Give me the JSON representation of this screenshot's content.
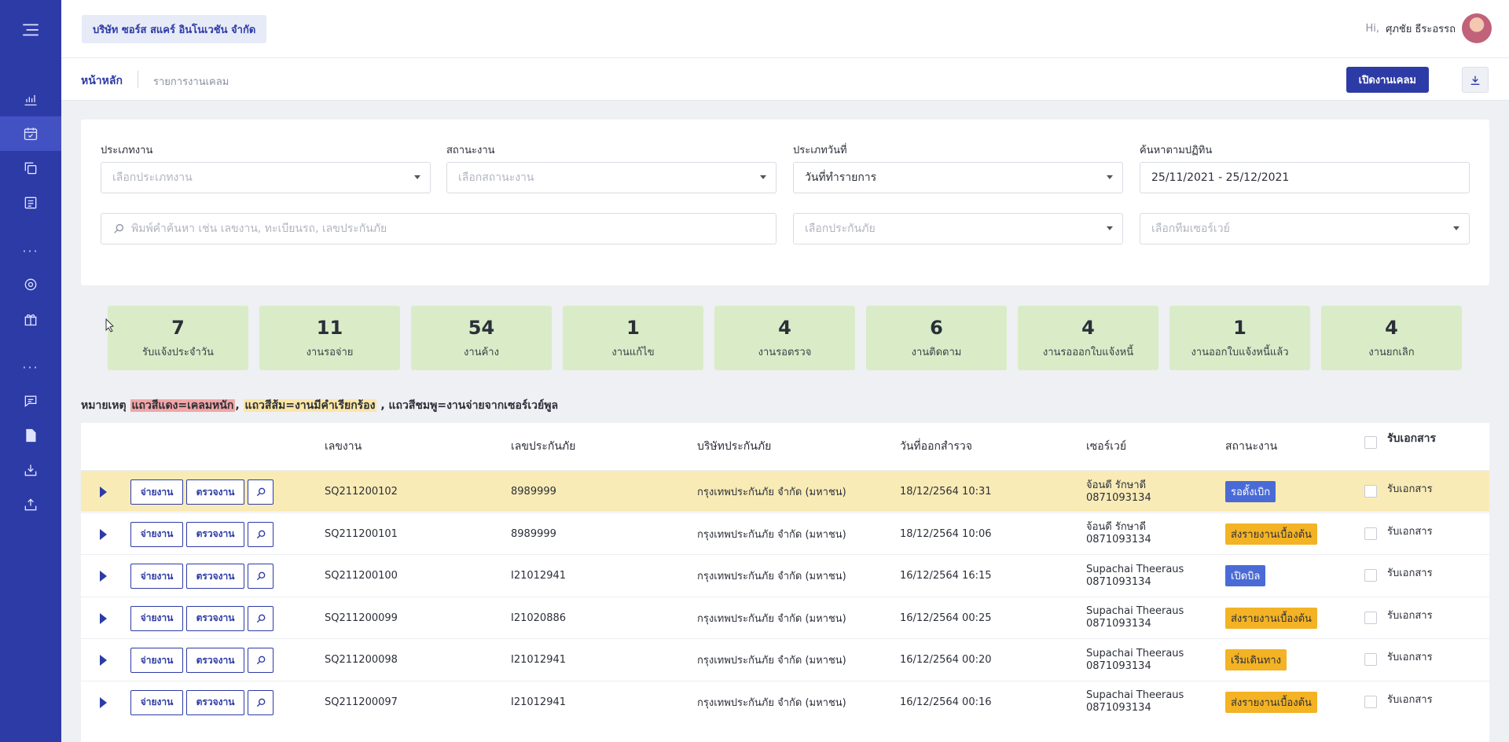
{
  "colors": {
    "sidebar": "#2d3ba6",
    "primary": "#2d3ba6",
    "card_bg": "#d9ecc7",
    "highlight_row": "#f9ebb5",
    "badge_blue": "#4a6bd6",
    "badge_orange": "#f3b325"
  },
  "header": {
    "company": "บริษัท ซอร์ส สแคร์ อินโนเวชัน จำกัด",
    "greeting": "Hi,",
    "user_name": "ศุภชัย ธีระอรรถ"
  },
  "breadcrumb": {
    "home": "หน้าหลัก",
    "current": "รายการงานเคลม"
  },
  "actions": {
    "open_claim": "เปิดงานเคลม",
    "download_icon": "download-icon"
  },
  "filters": {
    "job_type": {
      "label": "ประเภทงาน",
      "placeholder": "เลือกประเภทงาน"
    },
    "job_status": {
      "label": "สถานะงาน",
      "placeholder": "เลือกสถานะงาน"
    },
    "date_type": {
      "label": "ประเภทวันที่",
      "value": "วันที่ทำรายการ"
    },
    "date_range": {
      "label": "ค้นหาตามปฏิทิน",
      "value": "25/11/2021 - 25/12/2021"
    },
    "search": {
      "placeholder": "พิมพ์คำค้นหา เช่น เลขงาน, ทะเบียนรถ, เลขประกันภัย"
    },
    "insurer": {
      "placeholder": "เลือกประกันภัย"
    },
    "survey_team": {
      "placeholder": "เลือกทีมเซอร์เวย์"
    }
  },
  "summary": [
    {
      "count": "7",
      "label": "รับแจ้งประจำวัน"
    },
    {
      "count": "11",
      "label": "งานรอจ่าย"
    },
    {
      "count": "54",
      "label": "งานค้าง"
    },
    {
      "count": "1",
      "label": "งานแก้ไข"
    },
    {
      "count": "4",
      "label": "งานรอตรวจ"
    },
    {
      "count": "6",
      "label": "งานติดตาม"
    },
    {
      "count": "4",
      "label": "งานรอออกใบแจ้งหนี้"
    },
    {
      "count": "1",
      "label": "งานออกใบแจ้งหนี้แล้ว"
    },
    {
      "count": "4",
      "label": "งานยกเลิก"
    }
  ],
  "note": {
    "prefix": "หมายเหตุ",
    "red": "แถวสีแดง=เคลมหนัก",
    "sep1": ",",
    "orange": "แถวสีส้ม=งานมีคำเรียกร้อง",
    "rest": ", แถวสีชมพู=งานจ่ายจากเซอร์เวย์พูล"
  },
  "table": {
    "headers": {
      "job_no": "เลขงาน",
      "policy_no": "เลขประกันภัย",
      "insurer": "บริษัทประกันภัย",
      "survey_date": "วันที่ออกสำรวจ",
      "surveyor": "เซอร์เวย์",
      "status": "สถานะงาน",
      "receive_doc": "รับเอกสาร"
    },
    "action_labels": {
      "assign": "จ่ายงาน",
      "inspect": "ตรวจงาน"
    },
    "rows": [
      {
        "job_no": "SQ211200102",
        "policy_no": "8989999",
        "insurer": "กรุงเทพประกันภัย จำกัด (มหาชน)",
        "survey_date": "18/12/2564 10:31",
        "surveyor_name": "จ้อนดี รักษาดี",
        "surveyor_phone": "0871093134",
        "status": "รอตั้งเบิก",
        "status_color": "#4a6bd6",
        "status_text_color": "#ffffff",
        "receive_doc": "รับเอกสาร",
        "highlight": true
      },
      {
        "job_no": "SQ211200101",
        "policy_no": "8989999",
        "insurer": "กรุงเทพประกันภัย จำกัด (มหาชน)",
        "survey_date": "18/12/2564 10:06",
        "surveyor_name": "จ้อนดี รักษาดี",
        "surveyor_phone": "0871093134",
        "status": "ส่งรายงานเบื้องต้น",
        "status_color": "#f3b325",
        "status_text_color": "#2b2f38",
        "receive_doc": "รับเอกสาร",
        "highlight": false
      },
      {
        "job_no": "SQ211200100",
        "policy_no": "I21012941",
        "insurer": "กรุงเทพประกันภัย จำกัด (มหาชน)",
        "survey_date": "16/12/2564 16:15",
        "surveyor_name": "Supachai Theeraus",
        "surveyor_phone": "0871093134",
        "status": "เปิดบิล",
        "status_color": "#4a6bd6",
        "status_text_color": "#ffffff",
        "receive_doc": "รับเอกสาร",
        "highlight": false
      },
      {
        "job_no": "SQ211200099",
        "policy_no": "I21020886",
        "insurer": "กรุงเทพประกันภัย จำกัด (มหาชน)",
        "survey_date": "16/12/2564 00:25",
        "surveyor_name": "Supachai Theeraus",
        "surveyor_phone": "0871093134",
        "status": "ส่งรายงานเบื้องต้น",
        "status_color": "#f3b325",
        "status_text_color": "#2b2f38",
        "receive_doc": "รับเอกสาร",
        "highlight": false
      },
      {
        "job_no": "SQ211200098",
        "policy_no": "I21012941",
        "insurer": "กรุงเทพประกันภัย จำกัด (มหาชน)",
        "survey_date": "16/12/2564 00:20",
        "surveyor_name": "Supachai Theeraus",
        "surveyor_phone": "0871093134",
        "status": "เริ่มเดินทาง",
        "status_color": "#f3b325",
        "status_text_color": "#2b2f38",
        "receive_doc": "รับเอกสาร",
        "highlight": false
      },
      {
        "job_no": "SQ211200097",
        "policy_no": "I21012941",
        "insurer": "กรุงเทพประกันภัย จำกัด (มหาชน)",
        "survey_date": "16/12/2564 00:16",
        "surveyor_name": "Supachai Theeraus",
        "surveyor_phone": "0871093134",
        "status": "ส่งรายงานเบื้องต้น",
        "status_color": "#f3b325",
        "status_text_color": "#2b2f38",
        "receive_doc": "รับเอกสาร",
        "highlight": false
      }
    ]
  }
}
